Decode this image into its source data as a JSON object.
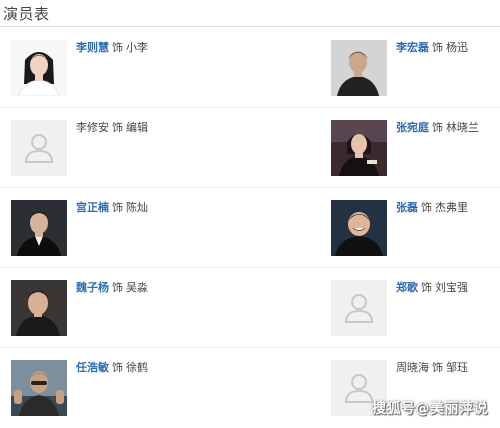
{
  "header": {
    "title": "演员表"
  },
  "cast": {
    "rows": [
      [
        {
          "actor": "李则慧",
          "sep": "饰",
          "character": "小李",
          "linked": true,
          "photo": "actor-photo-female"
        },
        {
          "actor": "李宏磊",
          "sep": "饰",
          "character": "杨迅",
          "linked": true,
          "photo": "actor-photo-male"
        }
      ],
      [
        {
          "actor": "李修安",
          "sep": "饰",
          "character": "编辑",
          "linked": false,
          "photo": "placeholder-avatar-icon"
        },
        {
          "actor": "张宛庭",
          "sep": "饰",
          "character": "林晓兰",
          "linked": true,
          "photo": "actor-photo-female"
        }
      ],
      [
        {
          "actor": "宫正楠",
          "sep": "饰",
          "character": "陈灿",
          "linked": true,
          "photo": "actor-photo-male"
        },
        {
          "actor": "张磊",
          "sep": "饰",
          "character": "杰弗里",
          "linked": true,
          "photo": "actor-photo-male"
        }
      ],
      [
        {
          "actor": "魏子杨",
          "sep": "饰",
          "character": "吴淼",
          "linked": true,
          "photo": "actor-photo-male"
        },
        {
          "actor": "郑歌",
          "sep": "饰",
          "character": "刘宝强",
          "linked": true,
          "photo": "placeholder-avatar-icon"
        }
      ],
      [
        {
          "actor": "任浩敏",
          "sep": "饰",
          "character": "徐鹤",
          "linked": true,
          "photo": "actor-photo-male"
        },
        {
          "actor": "周晓海",
          "sep": "饰",
          "character": "邹珏",
          "linked": false,
          "photo": "placeholder-avatar-icon"
        }
      ]
    ]
  },
  "watermark": {
    "text": "搜狐号@美丽萍说"
  }
}
